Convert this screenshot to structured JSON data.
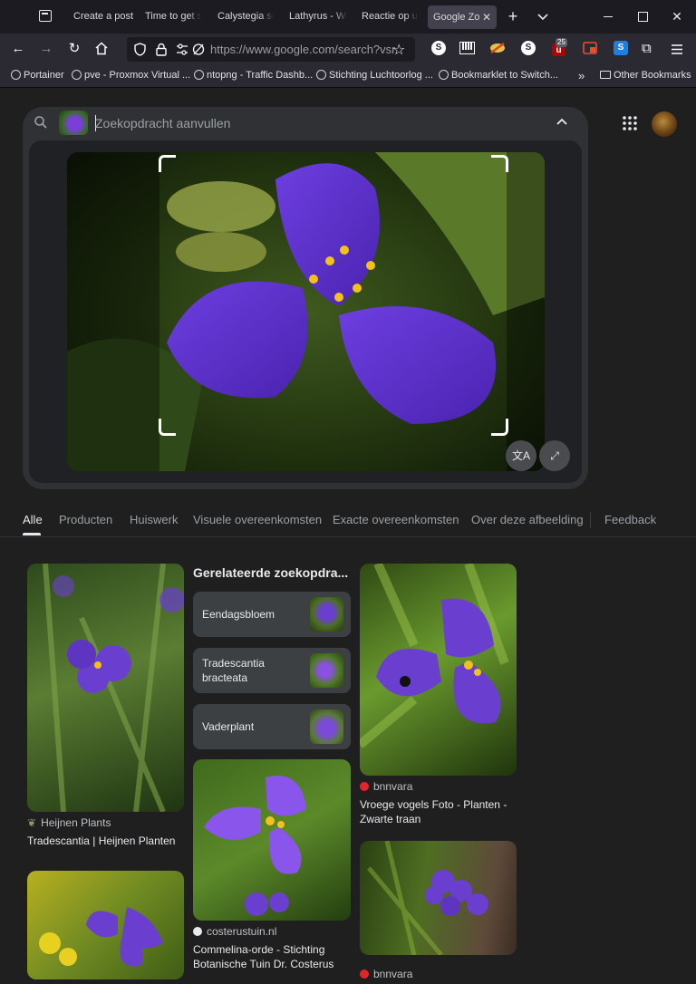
{
  "browser": {
    "tabs": [
      {
        "label": "Create a post"
      },
      {
        "label": "Time to get st"
      },
      {
        "label": "Calystegia sep"
      },
      {
        "label": "Lathyrus - Wik"
      },
      {
        "label": "Reactie op uw"
      },
      {
        "label": "Google Zo"
      }
    ],
    "new_tab_symbol": "+",
    "url": "https://www.google.com/search?vsrid",
    "bookmarks": [
      {
        "label": "Portainer"
      },
      {
        "label": "pve - Proxmox Virtual ..."
      },
      {
        "label": "ntopng - Traffic Dashb..."
      },
      {
        "label": "Stichting Luchtoorlog ..."
      },
      {
        "label": "Bookmarklet to Switch..."
      },
      {
        "label": "Other Bookmarks"
      }
    ],
    "extension_badge": "25"
  },
  "lens": {
    "placeholder": "Zoekopdracht aanvullen"
  },
  "filters": {
    "tabs": [
      {
        "label": "Alle"
      },
      {
        "label": "Producten"
      },
      {
        "label": "Huiswerk"
      },
      {
        "label": "Visuele overeenkomsten"
      },
      {
        "label": "Exacte overeenkomsten"
      },
      {
        "label": "Over deze afbeelding"
      }
    ],
    "feedback": "Feedback"
  },
  "results": {
    "related_heading": "Gerelateerde zoekopdra...",
    "related": [
      {
        "label": "Eendagsbloem"
      },
      {
        "label": "Tradescantia bracteata"
      },
      {
        "label": "Vaderplant"
      }
    ],
    "items": [
      {
        "source": "Heijnen Plants",
        "title": "Tradescantia | Heijnen Planten"
      },
      {
        "source": "bnnvara",
        "title": "Vroege vogels Foto - Planten - Zwarte traan"
      },
      {
        "source": "costerustuin.nl",
        "title": "Commelina-orde - Stichting Botanische Tuin Dr. Costerus"
      },
      {
        "source": "bnnvara",
        "title": ""
      }
    ]
  },
  "colors": {
    "accent_purple": "#6a3fd0",
    "page_bg": "#1f1f1f",
    "bnnvara_red": "#e2252b"
  }
}
